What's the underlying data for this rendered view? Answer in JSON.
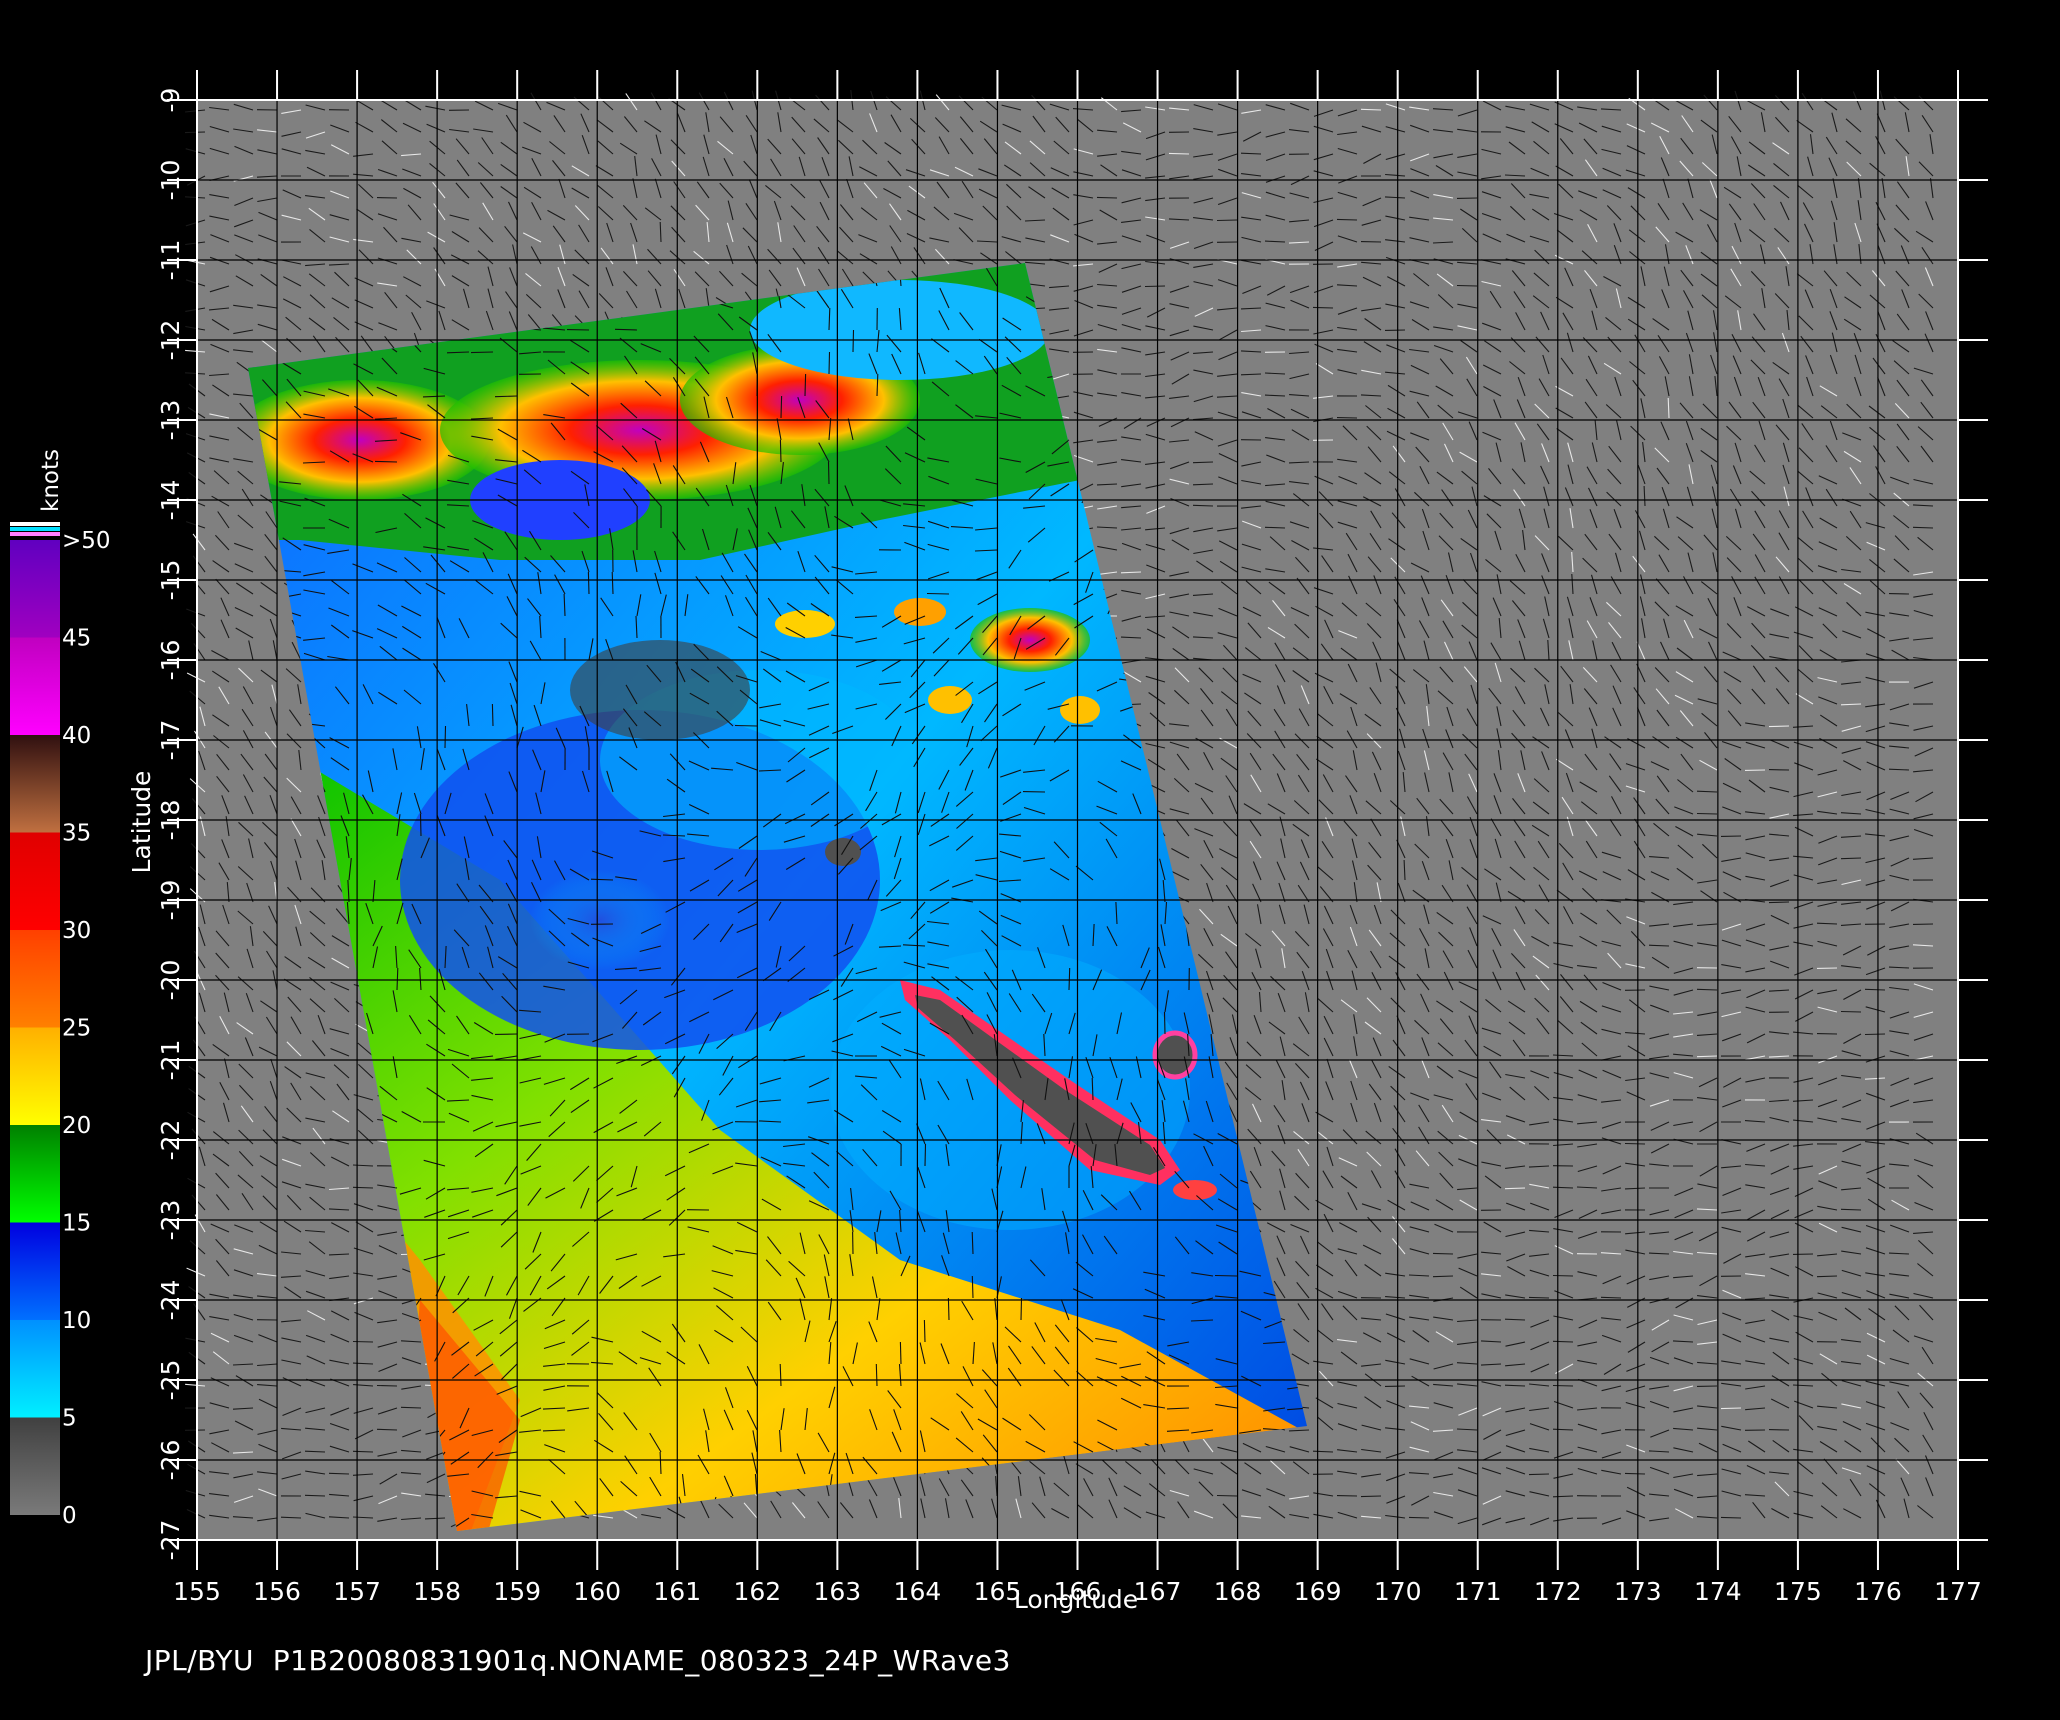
{
  "axes": {
    "xlabel": "Longitude",
    "ylabel": "Latitude",
    "x_ticks": [
      "155",
      "156",
      "157",
      "158",
      "159",
      "160",
      "161",
      "162",
      "163",
      "164",
      "165",
      "166",
      "167",
      "168",
      "169",
      "170",
      "171",
      "172",
      "173",
      "174",
      "175",
      "176",
      "177"
    ],
    "y_ticks": [
      "-9",
      "-10",
      "-11",
      "-12",
      "-13",
      "-14",
      "-15",
      "-16",
      "-17",
      "-18",
      "-19",
      "-20",
      "-21",
      "-22",
      "-23",
      "-24",
      "-25",
      "-26",
      "-27"
    ],
    "xlim": [
      155,
      177
    ],
    "ylim": [
      -27,
      -9
    ]
  },
  "colorbar": {
    "title": "knots",
    "labels": [
      ">50",
      "45",
      "40",
      "35",
      "30",
      "25",
      "20",
      "15",
      "10",
      "5",
      "0"
    ],
    "colors": {
      "0_5": [
        "#505050",
        "#7a7a7a"
      ],
      "5_10": [
        "#00f0ff",
        "#0090ff"
      ],
      "10_15": [
        "#0070ff",
        "#0000e0"
      ],
      "15_20": [
        "#00ff00",
        "#008000"
      ],
      "20_25": [
        "#ffff00",
        "#ffc000"
      ],
      "25_30": [
        "#ff8000",
        "#ff4000"
      ],
      "30_35": [
        "#ff0000",
        "#e00000"
      ],
      "35_40": [
        "#c07040",
        "#301010"
      ],
      "40_45": [
        "#ff00ff",
        "#c000c0"
      ],
      "45_50": [
        "#a000c0",
        "#6000c0"
      ]
    }
  },
  "footer_text": "JPL/BYU  P1B20080831901q.NONAME_080323_24P_WRave3",
  "colors": {
    "background": "#000000",
    "land_mask": "#808080",
    "grid": "#000000",
    "island": "#505050"
  }
}
